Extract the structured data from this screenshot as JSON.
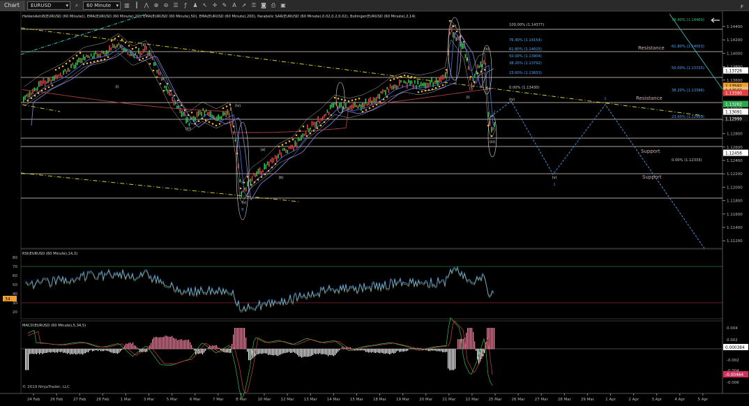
{
  "toolbar": {
    "chart_tab": "Chart",
    "instrument": "EURUSD",
    "timeframe": "60 Minute",
    "icons": [
      "search-icon",
      "bar-chart-icon",
      "candlestick-icon",
      "line-chart-icon",
      "zoom-in-icon",
      "zoom-out-icon",
      "properties-icon",
      "indicators-icon",
      "strategy-icon",
      "cursor-icon",
      "crosshair-icon",
      "draw-tool-icon",
      "text-tool-icon",
      "arrow-tool-icon",
      "lock-icon",
      "camera-icon",
      "print-icon",
      "template-icon"
    ]
  },
  "top_right_label": "F",
  "indicator_header": "HeikenAshi8(EURUSD (60 Minute)), EMA(EURUSD (60 Minute),20), EMA(EURUSD (60 Minute),50), EMA(EURUSD (60 Minute),200), Parabolic SAR(EURUSD (60 Minute),0.02,0.2,0.02), Bollinger(EURUSD (60 Minute),2,14)",
  "price_axis": {
    "ticks": [
      "1.14400",
      "1.14200",
      "1.14000",
      "1.13800",
      "1.13600",
      "1.13400",
      "1.13200",
      "1.13000",
      "1.12800",
      "1.12600",
      "1.12400",
      "1.12200",
      "1.12000",
      "1.11800",
      "1.11600",
      "1.11400",
      "1.11200"
    ],
    "badges": [
      {
        "label": "1.13726",
        "bg": "#ffffff",
        "fg": "#000000"
      },
      {
        "label": "1.13592",
        "bg": "#f0a030",
        "fg": "#000000"
      },
      {
        "label": "1.13502",
        "bg": "#e8c070",
        "fg": "#000000"
      },
      {
        "label": "1.13390",
        "bg": "#e04040",
        "fg": "#ffffff"
      },
      {
        "label": "1.13262",
        "bg": "#2aa84a",
        "fg": "#ffffff"
      },
      {
        "label": "1.13091",
        "bg": "#ffffff",
        "fg": "#000000"
      },
      {
        "label": "1.12999",
        "bg": "#111111",
        "fg": "#ffffff"
      },
      {
        "label": "1.12456",
        "bg": "#ffffff",
        "fg": "#000000"
      }
    ]
  },
  "levels": {
    "resistance_1": "Resistance",
    "resistance_2": "Resistance",
    "support_1": "Support",
    "support_2": "Support"
  },
  "fib_left": [
    "100.00% (1.14377)",
    "76.40% (1.14154)",
    "61.80% (1.14015)",
    "50.00% (1.13904)",
    "38.20% (1.13792)",
    "23.60% (1.13653)",
    "0.00% (1.13430)"
  ],
  "fib_right": [
    "76.40% (1.14469)",
    "61.80% (1.14053)",
    "50.00% (1.13725)",
    "38.20% (1.13396)",
    "23.60% (1.12999)",
    "0.00% (1.12333)"
  ],
  "wave_labels": [
    "(i)",
    "(ii)",
    "(iii)",
    "(iv)",
    "(v)",
    "(a)",
    "(b)",
    "(c)",
    "(i)",
    "(ii)",
    "(iii)",
    "(iv)",
    "(v)",
    "1",
    "2",
    "B"
  ],
  "rsi": {
    "header": "RSI(EURUSD (60 Minute),14,3)",
    "ticks": [
      "80",
      "70",
      "60",
      "50",
      "40",
      "30",
      "20"
    ],
    "value": "34"
  },
  "macd": {
    "header": "MACD(EURUSD (60 Minute),5,34,5)",
    "ticks": [
      "0.004",
      "0.002",
      "-0.002",
      "-0.004",
      "-0.006"
    ],
    "badge_pos": "0.000384",
    "badge_neg": "-0.00464"
  },
  "copyright": "© 2019 NinjaTrader, LLC",
  "date_axis": [
    "24 Feb",
    "26 Feb",
    "27 Feb",
    "28 Feb",
    "1 Mar",
    "3 Mar",
    "5 Mar",
    "6 Mar",
    "7 Mar",
    "8 Mar",
    "10 Mar",
    "12 Mar",
    "13 Mar",
    "14 Mar",
    "15 Mar",
    "18 Mar",
    "19 Mar",
    "20 Mar",
    "21 Mar",
    "22 Mar",
    "25 Mar",
    "26 Mar",
    "27 Mar",
    "28 Mar",
    "29 Mar",
    "1 Apr",
    "2 Apr",
    "3 Apr",
    "4 Apr",
    "5 Apr"
  ],
  "colors": {
    "background": "#000000",
    "resistance_line": "#e8d8d0",
    "trend_line": "#d8d020",
    "projection": "#4a90e0",
    "rsi": "#4aa8ff",
    "macd_hist": "#ff88aa"
  }
}
